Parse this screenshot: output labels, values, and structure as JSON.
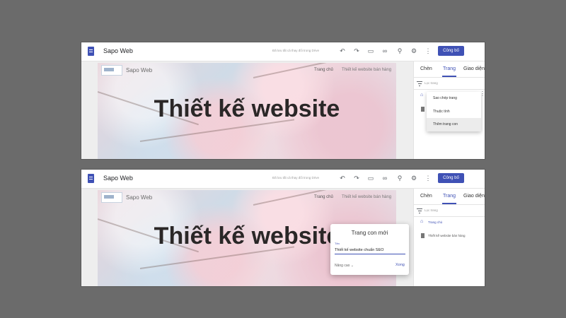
{
  "app": {
    "title": "Sapo Web",
    "save_status": "Đã lưu tất cả thay đổi trong Drive",
    "publish_label": "Công bố"
  },
  "toolbar_icons": [
    "undo-icon",
    "redo-icon",
    "preview-icon",
    "link-icon",
    "add-user-icon",
    "settings-icon",
    "more-vert-icon"
  ],
  "site": {
    "name": "Sapo Web",
    "nav_home": "Trang chủ",
    "nav_page": "Thiết kế website bán hàng",
    "hero_title": "Thiết kế website"
  },
  "panel": {
    "tabs": [
      "Chèn",
      "Trang",
      "Giao diện"
    ],
    "active_tab": "Trang",
    "filter_placeholder": "Lọc trang",
    "pages": [
      "Trang chủ",
      "Thiết kế website bán hàng"
    ]
  },
  "context_menu": {
    "items": [
      "Sao chép trang",
      "Thuộc tính",
      "Thêm trang con"
    ],
    "highlighted": "Thêm trang con"
  },
  "new_subpage_dialog": {
    "title": "Trang con mới",
    "field_label": "Tên",
    "field_value": "Thiết kế website chuẩn SEO",
    "advanced_label": "Nâng cao",
    "done_label": "Xong"
  },
  "colors": {
    "accent": "#3f51b5",
    "backdrop": "#6b6b6b"
  }
}
